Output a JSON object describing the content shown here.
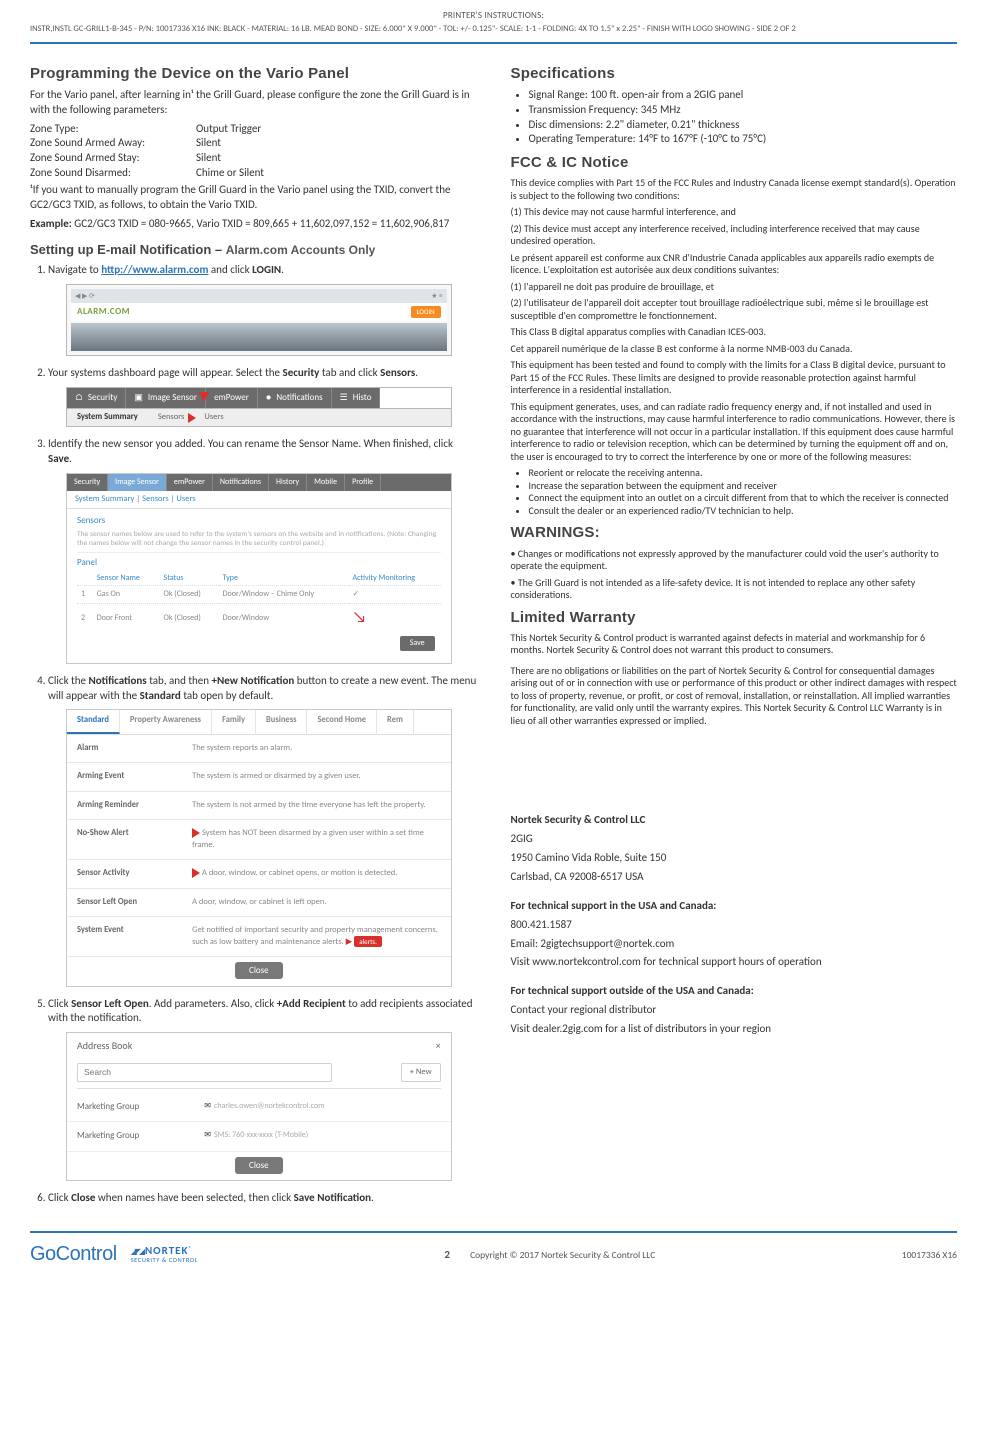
{
  "printer": {
    "line1": "PRINTER'S INSTRUCTIONS:",
    "line2": "INSTR,INSTL GC-GRILL1-B-345 - P/N: 10017336 X16  INK: BLACK - MATERIAL: 16 LB. MEAD BOND - SIZE: 6.000\" X 9.000\" - TOL: +/- 0.125\"- SCALE: 1-1 - FOLDING: 4X TO 1.5\" x 2.25\" - FINISH WITH LOGO SHOWING - SIDE 2 OF 2"
  },
  "left": {
    "h_prog": "Programming the Device on the Vario Panel",
    "prog_intro": "For the Vario panel, after learning in¹ the Grill Guard, please configure the zone the Grill Guard is in with the following parameters:",
    "zone_rows": [
      {
        "k": "Zone Type:",
        "v": "Output Trigger"
      },
      {
        "k": "Zone Sound Armed Away:",
        "v": "Silent"
      },
      {
        "k": "Zone Sound Armed Stay:",
        "v": "Silent"
      },
      {
        "k": "Zone Sound Disarmed:",
        "v": "Chime or Silent"
      }
    ],
    "footnote": "¹If you want to manually program the Grill Guard in the Vario panel using the TXID, convert the GC2/GC3 TXID, as follows, to obtain the Vario TXID.",
    "example_label": "Example:",
    "example_body": " GC2/GC3 TXID = 080-9665, Vario TXID = 809,665 + 11,602,097,152 = 11,602,906,817",
    "h_email": "Setting up E-mail Notification – ",
    "h_email_sub": "Alarm.com Accounts Only",
    "nav1_pre": "Navigate to ",
    "nav1_link": "http://www.alarm.com",
    "nav1_post": " and click ",
    "nav1_bold": "LOGIN",
    "fig1": {
      "logo": "ALARM.COM",
      "login": "LOGIN"
    },
    "step2_pre": "Your systems dashboard page will appear. Select the ",
    "step2_b1": "Security",
    "step2_mid": " tab and click ",
    "step2_b2": "Sensors",
    "tabs2": {
      "t1": "Security",
      "t2": "Image Sensor",
      "t3": "emPower",
      "t4": "Notifications",
      "t5": "Histo",
      "s1": "System Summary",
      "s2": "Sensors",
      "s3": "Users"
    },
    "step3_a": "Identify the new sensor you added. You can rename the Sensor Name. When finished, click ",
    "step3_b": "Save",
    "fig3": {
      "tabs": [
        "Security",
        "Image Sensor",
        "emPower",
        "Notifications",
        "History",
        "Mobile",
        "Profile"
      ],
      "sub": "System Summary  |  Sensors  |  Users",
      "sect": "Sensors",
      "note": "The sensor names below are used to refer to the system's sensors on the website and in notifications. (Note: Changing the names below will not change the sensor names in the security control panel.)",
      "panel": "Panel",
      "th": [
        "",
        "Sensor Name",
        "Status",
        "Type",
        "Activity Monitoring"
      ],
      "r1": [
        "1",
        "Gas On",
        "Ok (Closed)",
        "Door/Window – Chime Only",
        "✓"
      ],
      "r2": [
        "2",
        "Door Front",
        "Ok (Closed)",
        "Door/Window",
        ""
      ],
      "save": "Save"
    },
    "step4_a": "Click the ",
    "step4_b1": "Notifications",
    "step4_c": " tab, and then ",
    "step4_b2": "+New Notification",
    "step4_d": " button to create a new event. The menu will appear with the ",
    "step4_b3": "Standard",
    "step4_e": " tab open by default.",
    "fig4": {
      "tabs": [
        "Standard",
        "Property Awareness",
        "Family",
        "Business",
        "Second Home",
        "Rem"
      ],
      "rows": [
        {
          "k": "Alarm",
          "v": "The system reports an alarm."
        },
        {
          "k": "Arming Event",
          "v": "The system is armed or disarmed by a given user."
        },
        {
          "k": "Arming Reminder",
          "v": "The system is not armed by the time everyone has left the property."
        },
        {
          "k": "No-Show Alert",
          "v": "System has NOT been disarmed by a given user within a set time frame."
        },
        {
          "k": "Sensor Activity",
          "v": "A door, window, or cabinet opens, or motion is detected."
        },
        {
          "k": "Sensor Left Open",
          "v": "A door, window, or cabinet is left open."
        },
        {
          "k": "System Event",
          "v": "Get notified of important security and property management concerns, such as low battery and maintenance alerts."
        }
      ],
      "alerts": "alerts.",
      "close": "Close"
    },
    "step5_a": "Click ",
    "step5_b1": "Sensor Left Open",
    "step5_c": ". Add parameters. Also, click ",
    "step5_b2": "+Add Recipient",
    "step5_d": " to add recipients associated with the notification.",
    "fig5": {
      "title": "Address Book",
      "search_ph": "Search",
      "new": "+ New",
      "r1": {
        "nm": "Marketing Group",
        "val": "charles.owen@nortekcontrol.com"
      },
      "r2": {
        "nm": "Marketing Group",
        "val": "SMS: 760-xxx-xxxx (T-Mobile)"
      },
      "close": "Close"
    },
    "step6_a": "Click ",
    "step6_b1": "Close",
    "step6_c": " when names have been selected, then click ",
    "step6_b2": "Save Notification"
  },
  "right": {
    "h_spec": "Specifications",
    "specs": [
      "Signal Range: 100 ft. open-air from a 2GIG panel",
      "Transmission Frequency: 345 MHz",
      "Disc dimensions: 2.2\" diameter, 0.21\" thickness",
      "Operating Temperature: 14°F to 167°F (-10°C to 75°C)"
    ],
    "h_fcc": "FCC & IC Notice",
    "fcc1": "This device complies with Part 15 of the FCC Rules and Industry Canada license exempt standard(s). Operation is subject to the following two conditions:",
    "fcc_c1": "(1) This device may not cause harmful interference, and",
    "fcc_c2": "(2) This device must accept any interference received, including interference received that may cause undesired operation.",
    "fcc_fr": "Le présent appareil est conforme aux CNR d'Industrie Canada applicables aux appareils radio exempts de licence. L'exploitation est autorisée aux deux conditions suivantes:",
    "fcc_fr1": "(1) l'appareil ne doit pas produire de brouillage, et",
    "fcc_fr2": "(2) l'utilisateur de l'appareil doit accepter tout brouillage radioélectrique subi, même si le brouillage est susceptible d'en compromettre le fonctionnement.",
    "fcc_cb": "This Class B digital apparatus complies with Canadian ICES-003.",
    "fcc_cb_fr": "Cet appareil numérique de la classe B est conforme à la norme NMB-003 du Canada.",
    "fcc_eq": "This equipment has been tested and found to comply with the limits for a Class B digital device, pursuant to Part 15 of the FCC Rules. These limits are designed to provide reasonable protection against harmful interference in a residential installation.",
    "fcc_gen": "This equipment generates, uses, and can radiate radio frequency energy and, if not installed and used in accordance with the instructions, may cause harmful interference to radio communications. However, there is no guarantee that interference will not occur in a particular installation. If this equipment does cause harmful interference to radio or television reception, which can be determined by turning the equipment off and on, the user is encouraged to try to correct the interference by one or more of the following measures:",
    "fcc_meas": [
      "Reorient or relocate the receiving antenna.",
      "Increase the separation between the equipment and receiver",
      "Connect the equipment into an outlet on a circuit different from that to which the receiver is connected",
      "Consult the dealer or an experienced radio/TV technician to help."
    ],
    "h_warn": "WARNINGS:",
    "warn1": "• Changes or modifications not expressly approved by the manufacturer could void the user's authority to operate the equipment.",
    "warn2": "• The Grill Guard is not intended as a life-safety device. It is not intended to replace any other safety considerations.",
    "h_lw": "Limited Warranty",
    "lw1": "This Nortek Security & Control product is warranted against defects in material and workmanship for 6 months. Nortek Security & Control does not warrant this product to consumers.",
    "lw2": "There are no obligations or liabilities on the part of Nortek Security & Control for consequential damages arising out of or in connection with use or performance of this product or other indirect damages with respect to loss of property, revenue, or profit, or cost of removal, installation, or reinstallation. All implied warranties for functionality, are valid only until the warranty expires. This Nortek Security & Control LLC Warranty is in lieu of all other warranties expressed or implied.",
    "co": "Nortek Security & Control LLC",
    "co2": "2GIG",
    "co3": "1950 Camino Vida Roble, Suite 150",
    "co4": "Carlsbad, CA 92008-6517 USA",
    "ts_h": "For technical support in the USA and Canada:",
    "ts1": "800.421.1587",
    "ts2": "Email: 2gigtechsupport@nortek.com",
    "ts3": "Visit www.nortekcontrol.com for technical support hours of operation",
    "ts_h2": "For technical support outside of the USA and Canada:",
    "ts4": "Contact your regional distributor",
    "ts5": "Visit dealer.2gig.com for a list of distributors in your region"
  },
  "footer": {
    "gocontrol": "GoControl",
    "nortek_b": "NORTEK",
    "nortek_s": "SECURITY & CONTROL",
    "page": "2",
    "copy": "Copyright © 2017 Nortek Security & Control LLC",
    "pn": "10017336 X16"
  }
}
